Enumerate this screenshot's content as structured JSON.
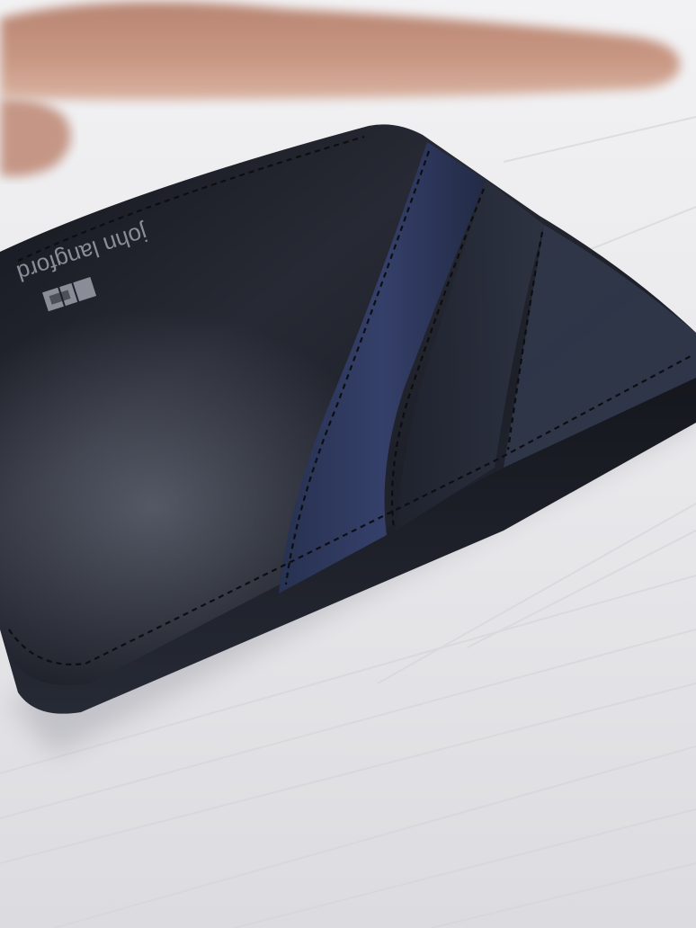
{
  "photo": {
    "subject": "wallet",
    "brand_text": "john langford",
    "colors": {
      "table": "#ebebee",
      "leather": "#1c1e27",
      "leather_highlight": "#4c5162",
      "stripe": "#2d3858",
      "stitch": "#0d0e12",
      "skin": "#c08e7a",
      "logo": "#8a8d98"
    }
  }
}
